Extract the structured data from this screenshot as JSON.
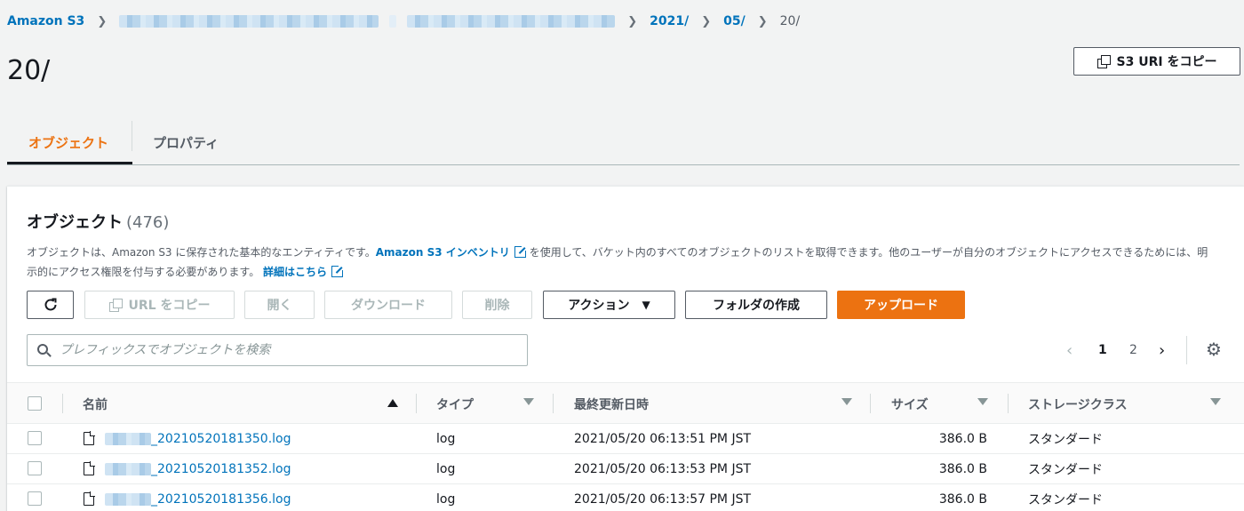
{
  "breadcrumb": {
    "root": "Amazon S3",
    "items": [
      "2021/",
      "05/"
    ],
    "current": "20/"
  },
  "page": {
    "title": "20/",
    "copy_uri_label": "S3 URI をコピー"
  },
  "tabs": [
    {
      "label": "オブジェクト",
      "active": true
    },
    {
      "label": "プロパティ",
      "active": false
    }
  ],
  "objects_panel": {
    "title": "オブジェクト",
    "count": "(476)",
    "desc_before_link": "オブジェクトは、Amazon S3 に保存された基本的なエンティティです。",
    "inventory_link": "Amazon S3 インベントリ",
    "desc_middle": "を使用して、バケット内のすべてのオブジェクトのリストを取得できます。他のユーザーが自分のオブジェクトにアクセスできるためには、明示的にアクセス権限を付与する必要があります。",
    "details_link": "詳細はこちら"
  },
  "toolbar": {
    "copy_url": "URL をコピー",
    "open": "開く",
    "download": "ダウンロード",
    "delete": "削除",
    "actions": "アクション",
    "create_folder": "フォルダの作成",
    "upload": "アップロード"
  },
  "search": {
    "placeholder": "プレフィックスでオブジェクトを検索",
    "value": ""
  },
  "pagination": {
    "pages": [
      "1",
      "2"
    ],
    "current": "1"
  },
  "columns": {
    "name": "名前",
    "type": "タイプ",
    "modified": "最終更新日時",
    "size": "サイズ",
    "storage_class": "ストレージクラス"
  },
  "rows": [
    {
      "name": "_20210520181350.log",
      "type": "log",
      "modified": "2021/05/20 06:13:51 PM JST",
      "size": "386.0 B",
      "storage_class": "スタンダード"
    },
    {
      "name": "_20210520181352.log",
      "type": "log",
      "modified": "2021/05/20 06:13:53 PM JST",
      "size": "386.0 B",
      "storage_class": "スタンダード"
    },
    {
      "name": "_20210520181356.log",
      "type": "log",
      "modified": "2021/05/20 06:13:57 PM JST",
      "size": "386.0 B",
      "storage_class": "スタンダード"
    }
  ],
  "colors": {
    "link": "#0073bb",
    "accent": "#ec7211",
    "text": "#16191f",
    "muted": "#545b64"
  }
}
